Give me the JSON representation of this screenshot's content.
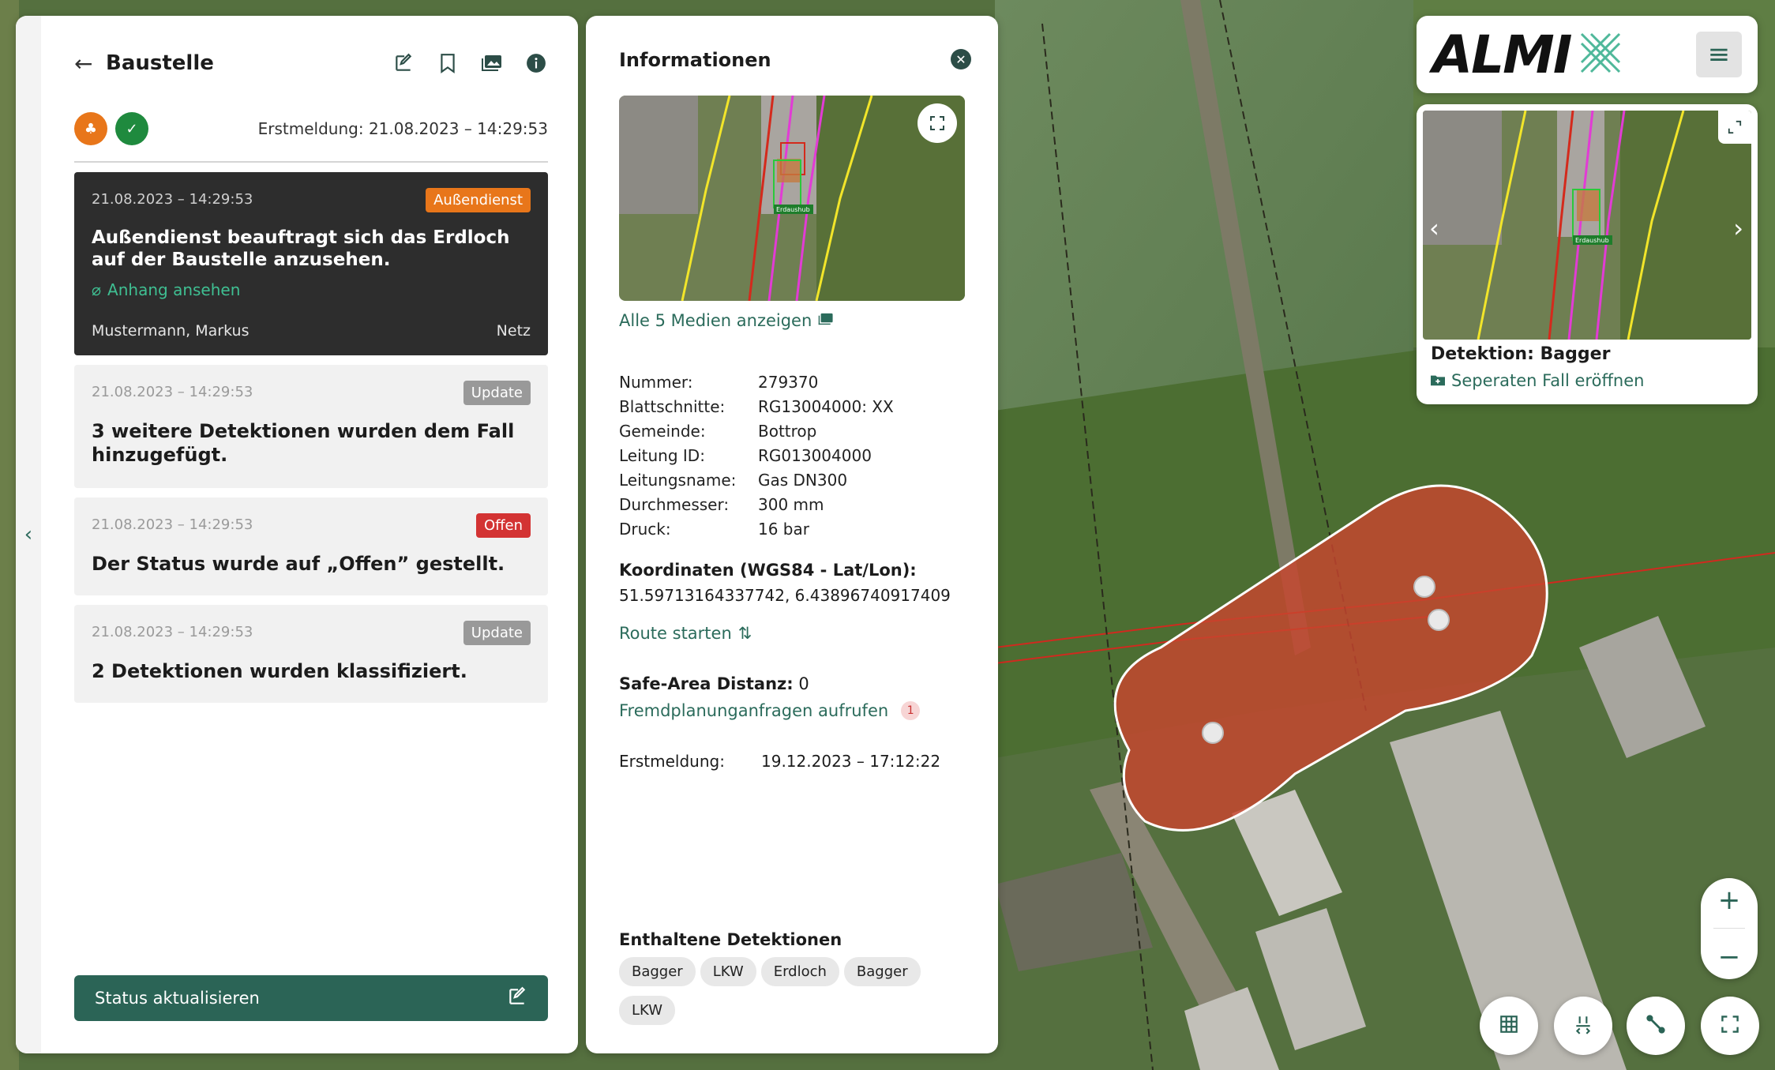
{
  "case": {
    "title": "Baustelle",
    "first_report": "Erstmeldung: 21.08.2023 – 14:29:53",
    "entries": [
      {
        "timestamp": "21.08.2023 – 14:29:53",
        "badge": "Außendienst",
        "message": "Außendienst beauftragt sich das Erdloch auf der Baustelle anzusehen.",
        "attachment": "Anhang ansehen",
        "author": "Mustermann, Markus",
        "department": "Netz"
      },
      {
        "timestamp": "21.08.2023 – 14:29:53",
        "badge": "Update",
        "message": "3 weitere Detektionen wurden dem Fall hinzugefügt."
      },
      {
        "timestamp": "21.08.2023 – 14:29:53",
        "badge": "Offen",
        "message": "Der Status wurde auf „Offen” gestellt."
      },
      {
        "timestamp": "21.08.2023 – 14:29:53",
        "badge": "Update",
        "message": "2 Detektionen wurden klassifiziert."
      }
    ],
    "status_button": "Status aktualisieren"
  },
  "info": {
    "title": "Informationen",
    "media_link": "Alle 5 Medien anzeigen",
    "thumb_label": "Erdaushub",
    "fields": [
      {
        "key": "Nummer:",
        "value": "279370"
      },
      {
        "key": "Blattschnitte:",
        "value": "RG13004000: XX"
      },
      {
        "key": "Gemeinde:",
        "value": "Bottrop"
      },
      {
        "key": "Leitung ID:",
        "value": "RG013004000"
      },
      {
        "key": "Leitungsname:",
        "value": "Gas DN300"
      },
      {
        "key": "Durchmesser:",
        "value": "300 mm"
      },
      {
        "key": "Druck:",
        "value": "16 bar"
      }
    ],
    "coords_label": "Koordinaten (WGS84 - Lat/Lon):",
    "coords_value": "51.59713164337742, 6.43896740917409",
    "route_link": "Route starten",
    "safe_area_label": "Safe-Area Distanz:",
    "safe_area_value": "0",
    "fremd_link": "Fremdplanunganfragen aufrufen",
    "fremd_count": "1",
    "erst_label": "Erstmeldung:",
    "erst_value": "19.12.2023 – 17:12:22",
    "detections_label": "Enthaltene Detektionen",
    "detections": [
      "Bagger",
      "LKW",
      "Erdloch",
      "Bagger",
      "LKW"
    ]
  },
  "brand": {
    "name": "ALMI"
  },
  "detection_card": {
    "title": "Detektion: Bagger",
    "link": "Seperaten Fall eröffnen",
    "thumb_label": "Erdaushub"
  },
  "colors": {
    "accent": "#2b6456",
    "link": "#2b6b5b",
    "orange": "#e8761a",
    "green": "#1f8a3e",
    "red": "#d33333",
    "area": "#c8452e"
  }
}
